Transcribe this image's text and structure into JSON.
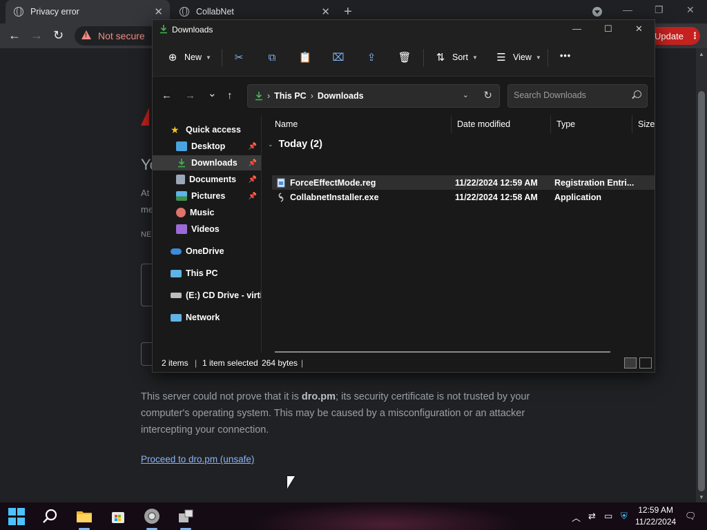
{
  "browser": {
    "tabs": [
      {
        "title": "Privacy error",
        "close": "✕"
      },
      {
        "title": "CollabNet",
        "close": "✕"
      }
    ],
    "newtab": "+",
    "window_controls": {
      "minimize": "—",
      "restore": "❐",
      "close": "✕"
    },
    "nav": {
      "back": "←",
      "forward": "→",
      "reload": "↻"
    },
    "security_label": "Not secure",
    "update_label": "Update",
    "menu_dots": "⋮",
    "page": {
      "heading_fragment": "Yo",
      "line_fragment_1": "At",
      "line_fragment_2": "me",
      "code_fragment": "NE",
      "paragraph_pre": "This server could not prove that it is ",
      "paragraph_domain": "dro.pm",
      "paragraph_post": "; its security certificate is not trusted by your computer's operating system. This may be caused by a misconfiguration or an attacker intercepting your connection.",
      "proceed_link": "Proceed to dro.pm (unsafe)"
    }
  },
  "explorer": {
    "title": "Downloads",
    "window_controls": {
      "minimize": "—",
      "maximize": "☐",
      "close": "✕"
    },
    "commands": {
      "new": "New",
      "sort": "Sort",
      "view": "View",
      "more": "•••"
    },
    "address": {
      "back": "←",
      "forward": "→",
      "recent": "⌄",
      "up": "↑",
      "crumbs": [
        "This PC",
        "Downloads"
      ],
      "separator": "›",
      "dropdown": "⌄",
      "refresh": "↻"
    },
    "search_placeholder": "Search Downloads",
    "nav": [
      {
        "label": "Quick access",
        "icon": "star-icon",
        "color": "#f5c518"
      },
      {
        "label": "Desktop",
        "icon": "desktop-icon",
        "color": "#4aa3df",
        "pinned": true
      },
      {
        "label": "Downloads",
        "icon": "download-icon",
        "color": "#3fb950",
        "pinned": true,
        "selected": true
      },
      {
        "label": "Documents",
        "icon": "documents-icon",
        "color": "#9aa7b8",
        "pinned": true
      },
      {
        "label": "Pictures",
        "icon": "pictures-icon",
        "color": "#5fb3e6",
        "pinned": true
      },
      {
        "label": "Music",
        "icon": "music-icon",
        "color": "#e0736a"
      },
      {
        "label": "Videos",
        "icon": "videos-icon",
        "color": "#9b6ad6"
      },
      {
        "label": "OneDrive",
        "icon": "onedrive-icon",
        "color": "#3d8bd9"
      },
      {
        "label": "This PC",
        "icon": "this-pc-icon",
        "color": "#5fb3e6"
      },
      {
        "label": "(E:) CD Drive - virtic",
        "icon": "cd-drive-icon",
        "color": "#bdbdbd"
      },
      {
        "label": "Network",
        "icon": "network-icon",
        "color": "#5fb3e6"
      }
    ],
    "pin_glyph": "📌",
    "columns": [
      "Name",
      "Date modified",
      "Type",
      "Size"
    ],
    "group": {
      "label": "Today (2)",
      "chevron": "⌄"
    },
    "files": [
      {
        "name": "ForceEffectMode.reg",
        "date": "11/22/2024 12:59 AM",
        "type": "Registration Entri...",
        "icon": "reg-file-icon",
        "selected": true
      },
      {
        "name": "CollabnetInstaller.exe",
        "date": "11/22/2024 12:58 AM",
        "type": "Application",
        "icon": "exe-file-icon",
        "selected": false
      }
    ],
    "status": {
      "items": "2 items",
      "selected": "1 item selected",
      "size": "264 bytes",
      "bar": "|"
    }
  },
  "taskbar": {
    "apps": [
      "start-icon",
      "search-icon",
      "file-explorer-icon",
      "store-icon",
      "chrome-icon",
      "installer-icon"
    ],
    "tray": {
      "chevron": "︿",
      "clock_time": "12:59 AM",
      "clock_date": "11/22/2024"
    }
  },
  "colors": {
    "accent": "#4cc2ff",
    "warning_red": "#f28b82",
    "update_red": "#c5221f",
    "link": "#8ab4f8"
  }
}
